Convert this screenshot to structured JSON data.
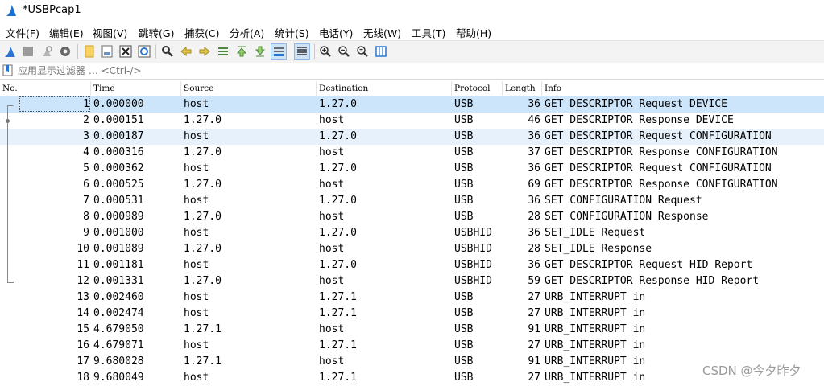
{
  "window": {
    "title": "*USBPcap1"
  },
  "menu": [
    "文件(F)",
    "编辑(E)",
    "视图(V)",
    "跳转(G)",
    "捕获(C)",
    "分析(A)",
    "统计(S)",
    "电话(Y)",
    "无线(W)",
    "工具(T)",
    "帮助(H)"
  ],
  "toolbar": {
    "icons": [
      "shark-fin-start-icon",
      "stop-icon",
      "restart-icon",
      "capture-options-icon",
      "open-file-icon",
      "save-file-icon",
      "close-file-icon",
      "reload-icon",
      "find-packet-icon",
      "go-back-icon",
      "go-forward-icon",
      "go-to-packet-icon",
      "go-first-icon",
      "go-last-icon",
      "autoscroll-icon",
      "colorize-icon",
      "zoom-in-icon",
      "zoom-out-icon",
      "zoom-normal-icon",
      "resize-columns-icon"
    ]
  },
  "filter": {
    "placeholder": "应用显示过滤器 … <Ctrl-/>"
  },
  "columns": {
    "no": "No.",
    "time": "Time",
    "source": "Source",
    "destination": "Destination",
    "protocol": "Protocol",
    "length": "Length",
    "info": "Info"
  },
  "packets": [
    {
      "no": "1",
      "time": "0.000000",
      "src": "host",
      "dst": "1.27.0",
      "proto": "USB",
      "len": "36",
      "info": "GET DESCRIPTOR Request DEVICE"
    },
    {
      "no": "2",
      "time": "0.000151",
      "src": "1.27.0",
      "dst": "host",
      "proto": "USB",
      "len": "46",
      "info": "GET DESCRIPTOR Response DEVICE"
    },
    {
      "no": "3",
      "time": "0.000187",
      "src": "host",
      "dst": "1.27.0",
      "proto": "USB",
      "len": "36",
      "info": "GET DESCRIPTOR Request CONFIGURATION"
    },
    {
      "no": "4",
      "time": "0.000316",
      "src": "1.27.0",
      "dst": "host",
      "proto": "USB",
      "len": "37",
      "info": "GET DESCRIPTOR Response CONFIGURATION"
    },
    {
      "no": "5",
      "time": "0.000362",
      "src": "host",
      "dst": "1.27.0",
      "proto": "USB",
      "len": "36",
      "info": "GET DESCRIPTOR Request CONFIGURATION"
    },
    {
      "no": "6",
      "time": "0.000525",
      "src": "1.27.0",
      "dst": "host",
      "proto": "USB",
      "len": "69",
      "info": "GET DESCRIPTOR Response CONFIGURATION"
    },
    {
      "no": "7",
      "time": "0.000531",
      "src": "host",
      "dst": "1.27.0",
      "proto": "USB",
      "len": "36",
      "info": "SET CONFIGURATION Request"
    },
    {
      "no": "8",
      "time": "0.000989",
      "src": "1.27.0",
      "dst": "host",
      "proto": "USB",
      "len": "28",
      "info": "SET CONFIGURATION Response"
    },
    {
      "no": "9",
      "time": "0.001000",
      "src": "host",
      "dst": "1.27.0",
      "proto": "USBHID",
      "len": "36",
      "info": "SET_IDLE Request"
    },
    {
      "no": "10",
      "time": "0.001089",
      "src": "1.27.0",
      "dst": "host",
      "proto": "USBHID",
      "len": "28",
      "info": "SET_IDLE Response"
    },
    {
      "no": "11",
      "time": "0.001181",
      "src": "host",
      "dst": "1.27.0",
      "proto": "USBHID",
      "len": "36",
      "info": "GET DESCRIPTOR Request HID Report"
    },
    {
      "no": "12",
      "time": "0.001331",
      "src": "1.27.0",
      "dst": "host",
      "proto": "USBHID",
      "len": "59",
      "info": "GET DESCRIPTOR Response HID Report"
    },
    {
      "no": "13",
      "time": "0.002460",
      "src": "host",
      "dst": "1.27.1",
      "proto": "USB",
      "len": "27",
      "info": "URB_INTERRUPT in"
    },
    {
      "no": "14",
      "time": "0.002474",
      "src": "host",
      "dst": "1.27.1",
      "proto": "USB",
      "len": "27",
      "info": "URB_INTERRUPT in"
    },
    {
      "no": "15",
      "time": "4.679050",
      "src": "1.27.1",
      "dst": "host",
      "proto": "USB",
      "len": "91",
      "info": "URB_INTERRUPT in"
    },
    {
      "no": "16",
      "time": "4.679071",
      "src": "host",
      "dst": "1.27.1",
      "proto": "USB",
      "len": "27",
      "info": "URB_INTERRUPT in"
    },
    {
      "no": "17",
      "time": "9.680028",
      "src": "1.27.1",
      "dst": "host",
      "proto": "USB",
      "len": "91",
      "info": "URB_INTERRUPT in"
    },
    {
      "no": "18",
      "time": "9.680049",
      "src": "host",
      "dst": "1.27.1",
      "proto": "USB",
      "len": "27",
      "info": "URB_INTERRUPT in"
    }
  ],
  "watermark": "CSDN @今夕昨夕",
  "colors": {
    "row_highlight": "#e6f1fb",
    "row_selected": "#cde5fa",
    "accent": "#1a6fd1"
  }
}
